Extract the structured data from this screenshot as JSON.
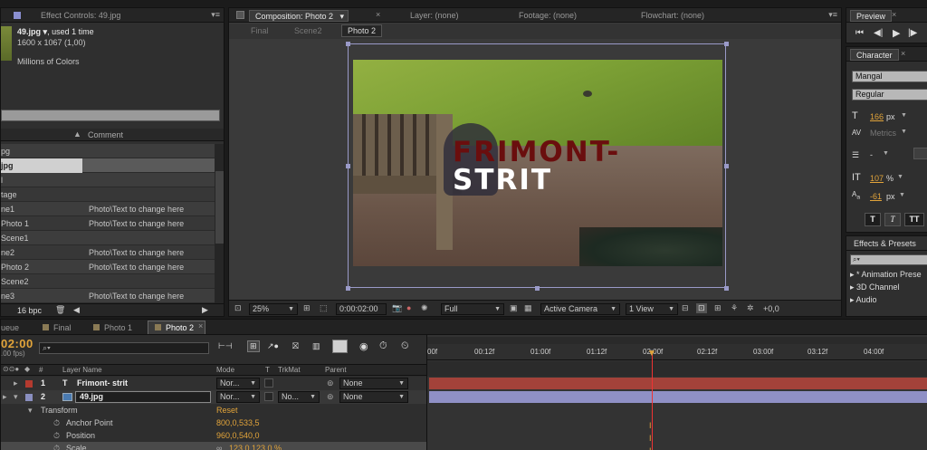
{
  "project": {
    "title": "Effect Controls: 49.jpg",
    "item_name": "49.jpg",
    "item_used": ", used 1 time",
    "item_size": "1600 x 1067 (1,00)",
    "item_colors": "Millions of Colors",
    "comment_header": "Comment",
    "rows": [
      {
        "name": "pg",
        "comment": ""
      },
      {
        "name": "jpg",
        "comment": ""
      },
      {
        "name": "l",
        "comment": ""
      },
      {
        "name": "tage",
        "comment": ""
      },
      {
        "name": "ne1",
        "comment": "Photo\\Text to change here"
      },
      {
        "name": "Photo 1",
        "comment": "Photo\\Text to change here"
      },
      {
        "name": "Scene1",
        "comment": ""
      },
      {
        "name": "ne2",
        "comment": "Photo\\Text to change here"
      },
      {
        "name": "Photo 2",
        "comment": "Photo\\Text to change here"
      },
      {
        "name": "Scene2",
        "comment": ""
      },
      {
        "name": "ne3",
        "comment": "Photo\\Text to change here"
      }
    ],
    "bpc": "16 bpc"
  },
  "comp": {
    "title": "Composition: Photo 2",
    "layer_tab": "Layer: (none)",
    "footage_tab": "Footage: (none)",
    "flowchart_tab": "Flowchart: (none)",
    "breadcrumbs": [
      "Final",
      "Scene2",
      "Photo 2"
    ],
    "text_line1": "FRIMONT-",
    "text_line2": "STRIT",
    "footer": {
      "zoom": "25%",
      "time": "0:00:02:00",
      "quality": "Full",
      "camera": "Active Camera",
      "views": "1 View",
      "exposure": "+0,0"
    }
  },
  "preview": {
    "title": "Preview",
    "controls": [
      "first-frame",
      "prev-frame",
      "play",
      "next-frame"
    ]
  },
  "character": {
    "title": "Character",
    "font": "Mangal",
    "style": "Regular",
    "size_value": "166",
    "size_unit": "px",
    "leading_label": "Metrics",
    "tracking_value": "107",
    "tracking_unit": "%",
    "baseline_value": "-61",
    "baseline_unit": "px",
    "style_buttons": [
      "T",
      "T",
      "TT"
    ]
  },
  "effects": {
    "title": "Effects & Presets",
    "items": [
      "* Animation Prese",
      "3D Channel",
      "Audio"
    ]
  },
  "timeline": {
    "tabs": [
      "ueue",
      "Final",
      "Photo 1",
      "Photo 2"
    ],
    "active_tab_index": 3,
    "timecode": "02:00",
    "fps": ".00 fps)",
    "columns": {
      "hash": "#",
      "layer_name": "Layer Name",
      "mode": "Mode",
      "t": "T",
      "trkmat": "TrkMat",
      "parent": "Parent"
    },
    "layers": [
      {
        "num": "1",
        "name": "Frimont- strit",
        "mode": "Nor...",
        "trkmat": "",
        "parent": "None",
        "color": "#b33a2f"
      },
      {
        "num": "2",
        "name": "49.jpg",
        "mode": "Nor...",
        "trkmat": "No...",
        "parent": "None",
        "color": "#8a8fc0"
      }
    ],
    "transform_label": "Transform",
    "transform_reset": "Reset",
    "properties": [
      {
        "name": "Anchor Point",
        "value": "800,0,533,5"
      },
      {
        "name": "Position",
        "value": "960,0,540,0"
      },
      {
        "name": "Scale",
        "value": "123,0,123,0 %"
      }
    ],
    "ruler": [
      "00f",
      "00:12f",
      "01:00f",
      "01:12f",
      "02:00f",
      "02:12f",
      "03:00f",
      "03:12f",
      "04:00f"
    ],
    "bar_colors": {
      "layer1": "#a3423a",
      "layer2": "#8f90c6"
    }
  }
}
